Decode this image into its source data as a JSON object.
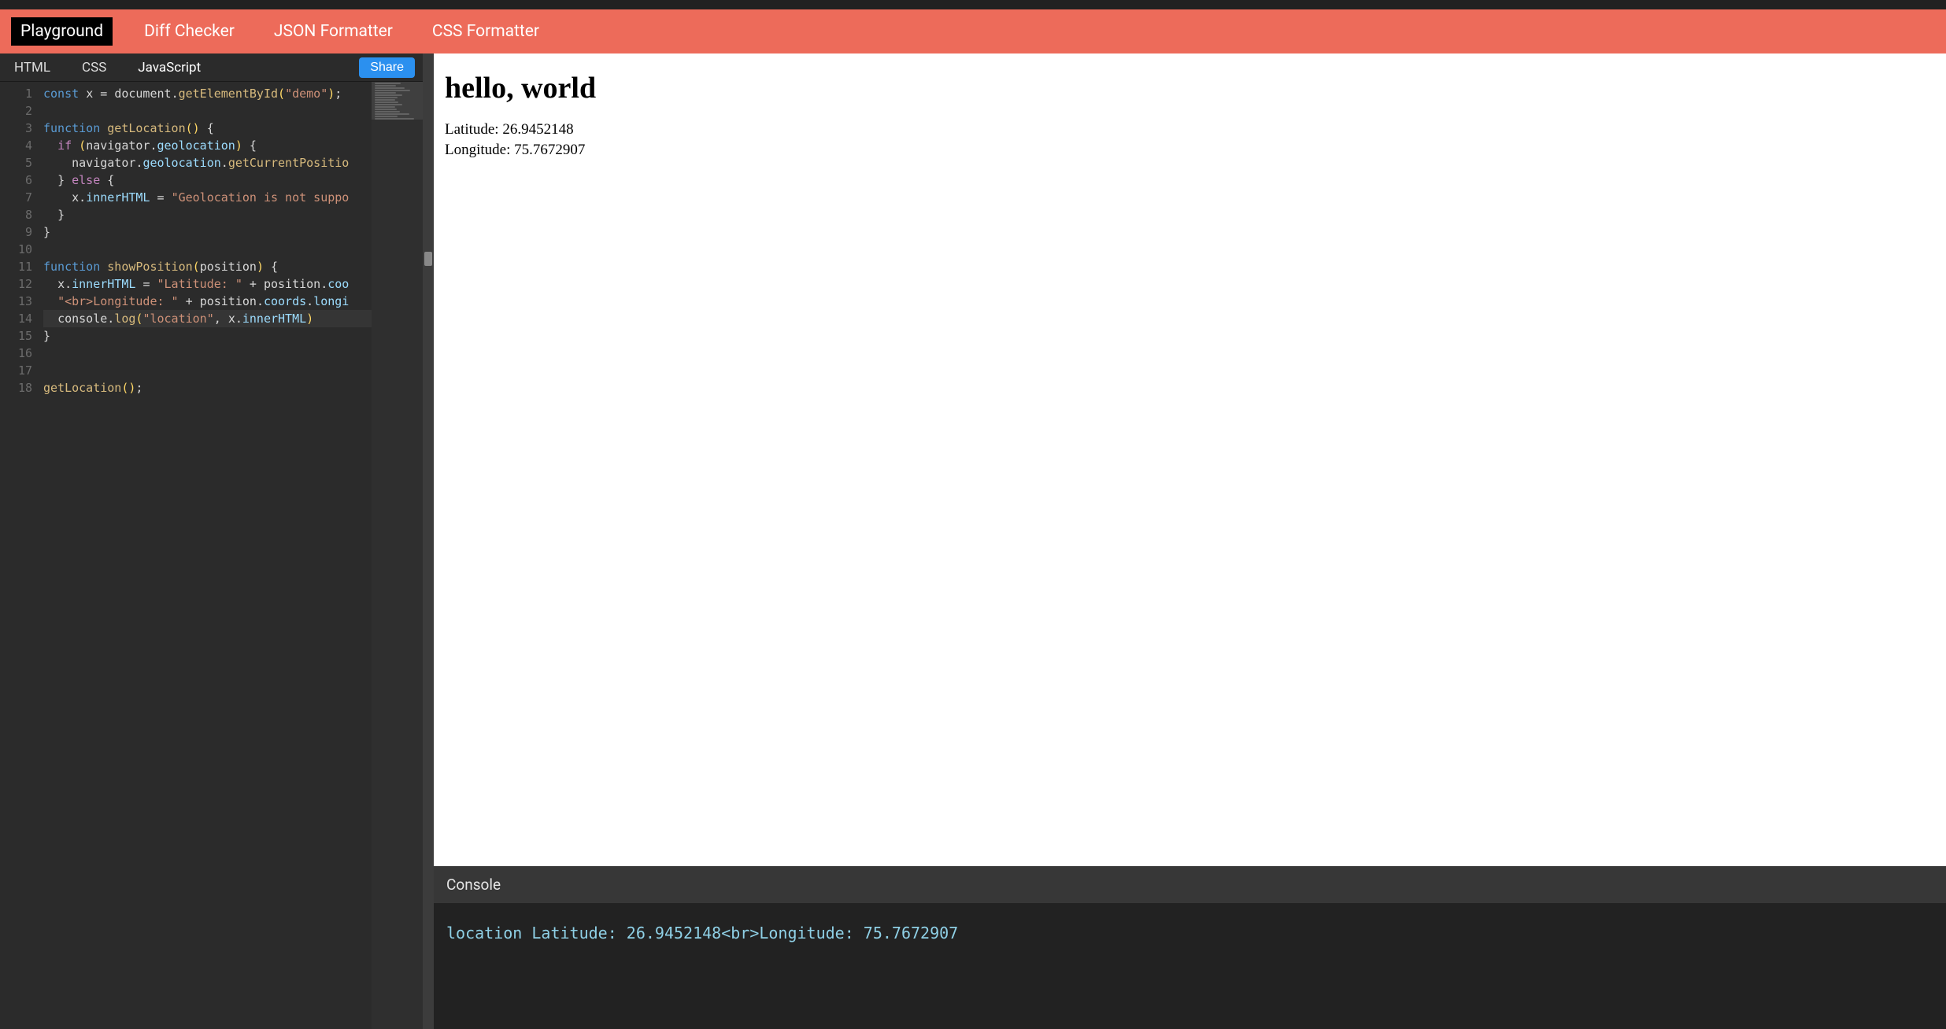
{
  "header": {
    "nav": [
      {
        "label": "Playground",
        "active": true
      },
      {
        "label": "Diff Checker",
        "active": false
      },
      {
        "label": "JSON Formatter",
        "active": false
      },
      {
        "label": "CSS Formatter",
        "active": false
      }
    ]
  },
  "editor": {
    "tabs": [
      {
        "label": "HTML",
        "active": false
      },
      {
        "label": "CSS",
        "active": false
      },
      {
        "label": "JavaScript",
        "active": true
      }
    ],
    "share_label": "Share",
    "line_count": 18,
    "highlighted_line": 14,
    "code_raw": "const x = document.getElementById(\"demo\");\n\nfunction getLocation() {\n  if (navigator.geolocation) {\n    navigator.geolocation.getCurrentPosition(showPosition);\n  } else {\n    x.innerHTML = \"Geolocation is not supported by this browser.\";\n  }\n}\n\nfunction showPosition(position) {\n  x.innerHTML = \"Latitude: \" + position.coords.latitude +\n  \"<br>Longitude: \" + position.coords.longitude;\n  console.log(\"location\", x.innerHTML)\n}\n\n\ngetLocation();",
    "code_lines_html": [
      "<span class='tok-kw2'>const</span> <span class='tok-var'>x</span> <span class='tok-pun'>=</span> <span class='tok-var'>document</span><span class='tok-pun'>.</span><span class='tok-call'>getElementById</span><span class='tok-par'>(</span><span class='tok-str'>\"demo\"</span><span class='tok-par'>)</span><span class='tok-pun'>;</span>",
      "",
      "<span class='tok-kw2'>function</span> <span class='tok-call'>getLocation</span><span class='tok-par'>()</span> <span class='tok-pun'>{</span>",
      "  <span class='tok-kw'>if</span> <span class='tok-par'>(</span><span class='tok-var'>navigator</span><span class='tok-pun'>.</span><span class='tok-prop'>geolocation</span><span class='tok-par'>)</span> <span class='tok-pun'>{</span>",
      "    <span class='tok-var'>navigator</span><span class='tok-pun'>.</span><span class='tok-prop'>geolocation</span><span class='tok-pun'>.</span><span class='tok-call'>getCurrentPositio</span>",
      "  <span class='tok-pun'>}</span> <span class='tok-kw'>else</span> <span class='tok-pun'>{</span>",
      "    <span class='tok-var'>x</span><span class='tok-pun'>.</span><span class='tok-prop'>innerHTML</span> <span class='tok-pun'>=</span> <span class='tok-str'>\"Geolocation is not suppo</span>",
      "  <span class='tok-pun'>}</span>",
      "<span class='tok-pun'>}</span>",
      "",
      "<span class='tok-kw2'>function</span> <span class='tok-call'>showPosition</span><span class='tok-par'>(</span><span class='tok-var'>position</span><span class='tok-par'>)</span> <span class='tok-pun'>{</span>",
      "  <span class='tok-var'>x</span><span class='tok-pun'>.</span><span class='tok-prop'>innerHTML</span> <span class='tok-pun'>=</span> <span class='tok-str'>\"Latitude: \"</span> <span class='tok-pun'>+</span> <span class='tok-var'>position</span><span class='tok-pun'>.</span><span class='tok-prop'>coo</span>",
      "  <span class='tok-str'>\"&lt;br&gt;Longitude: \"</span> <span class='tok-pun'>+</span> <span class='tok-var'>position</span><span class='tok-pun'>.</span><span class='tok-prop'>coords</span><span class='tok-pun'>.</span><span class='tok-prop'>longi</span>",
      "  <span class='tok-var'>console</span><span class='tok-pun'>.</span><span class='tok-call'>log</span><span class='tok-par'>(</span><span class='tok-str'>\"location\"</span><span class='tok-pun'>,</span> <span class='tok-var'>x</span><span class='tok-pun'>.</span><span class='tok-prop'>innerHTML</span><span class='tok-par'>)</span>",
      "<span class='tok-pun'>}</span>",
      "",
      "",
      "<span class='tok-call'>getLocation</span><span class='tok-par'>()</span><span class='tok-pun'>;</span>"
    ]
  },
  "preview": {
    "heading": "hello, world",
    "latitude_label": "Latitude: ",
    "latitude_value": "26.9452148",
    "longitude_label": "Longitude: ",
    "longitude_value": "75.7672907"
  },
  "console": {
    "title": "Console",
    "entries": [
      "location Latitude: 26.9452148<br>Longitude: 75.7672907"
    ]
  }
}
